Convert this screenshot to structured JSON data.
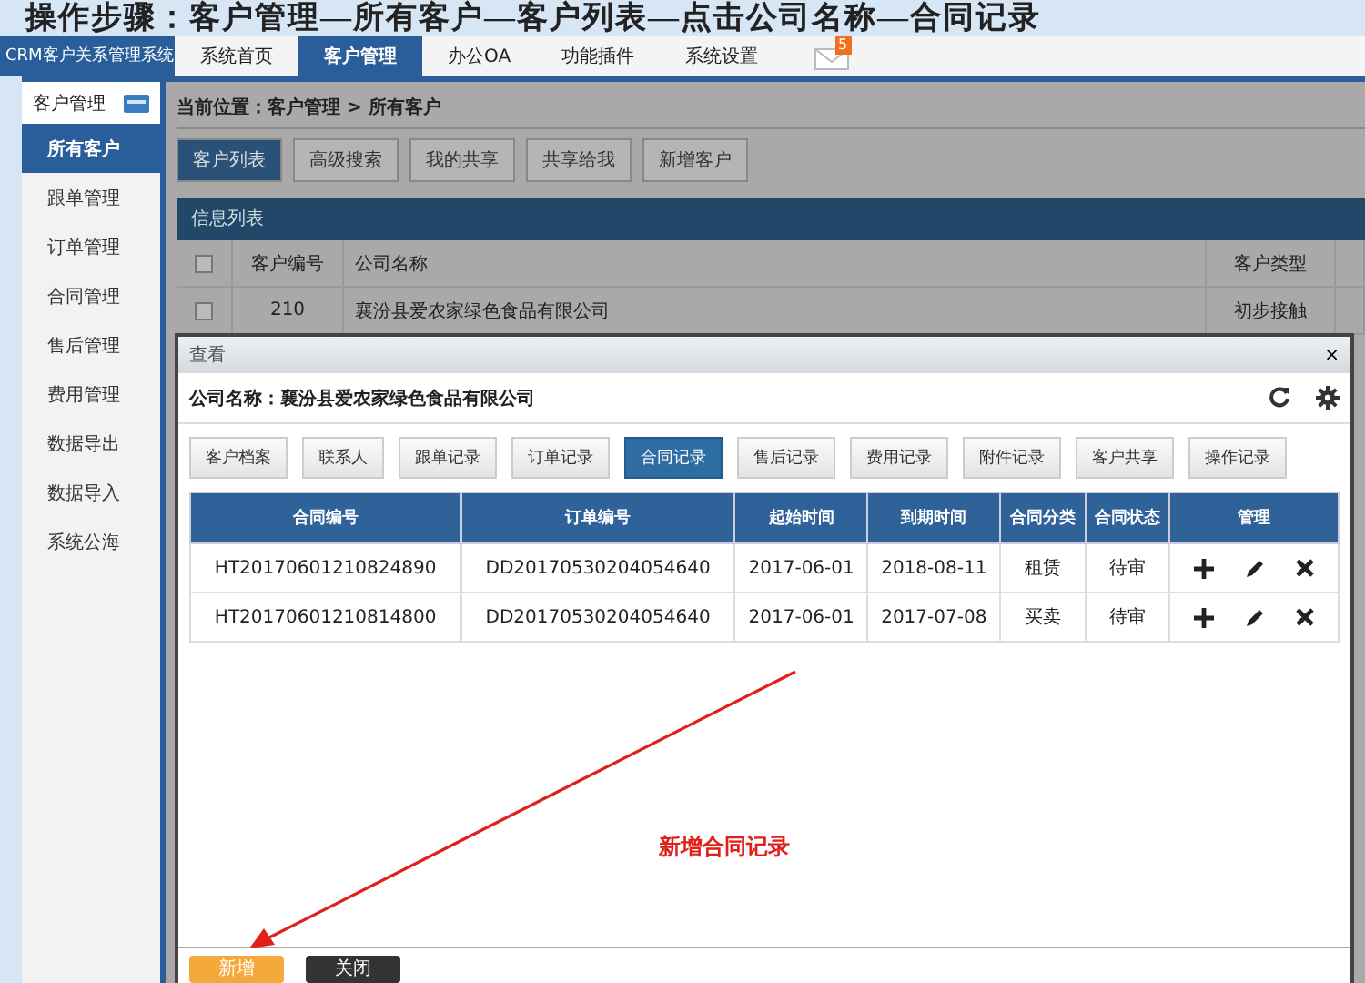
{
  "instruction_banner": "操作步骤：客户管理—所有客户—客户列表—点击公司名称—合同记录",
  "app_title": "CRM客户关系管理系统",
  "nav_tabs": [
    {
      "label": "系统首页",
      "selected": false
    },
    {
      "label": "客户管理",
      "selected": true
    },
    {
      "label": "办公OA",
      "selected": false
    },
    {
      "label": "功能插件",
      "selected": false
    },
    {
      "label": "系统设置",
      "selected": false
    }
  ],
  "mail_badge": "5",
  "sidebar": {
    "title": "客户管理",
    "items": [
      {
        "label": "所有客户",
        "selected": true
      },
      {
        "label": "跟单管理",
        "selected": false
      },
      {
        "label": "订单管理",
        "selected": false
      },
      {
        "label": "合同管理",
        "selected": false
      },
      {
        "label": "售后管理",
        "selected": false
      },
      {
        "label": "费用管理",
        "selected": false
      },
      {
        "label": "数据导出",
        "selected": false
      },
      {
        "label": "数据导入",
        "selected": false
      },
      {
        "label": "系统公海",
        "selected": false
      }
    ]
  },
  "breadcrumb": "当前位置：客户管理 > 所有客户",
  "toolbar_buttons": [
    {
      "label": "客户列表",
      "selected": true
    },
    {
      "label": "高级搜索",
      "selected": false
    },
    {
      "label": "我的共享",
      "selected": false
    },
    {
      "label": "共享给我",
      "selected": false
    },
    {
      "label": "新增客户",
      "selected": false
    }
  ],
  "list_panel": {
    "title": "信息列表",
    "header_checked": false,
    "columns": [
      "客户编号",
      "公司名称",
      "客户类型"
    ],
    "rows": [
      {
        "checked": false,
        "cells": [
          "210",
          "襄汾县爱农家绿色食品有限公司",
          "初步接触"
        ]
      }
    ]
  },
  "dialog": {
    "title": "查看",
    "close": "×",
    "company": "公司名称：襄汾县爱农家绿色食品有限公司",
    "tabs": [
      {
        "label": "客户档案",
        "selected": false
      },
      {
        "label": "联系人",
        "selected": false
      },
      {
        "label": "跟单记录",
        "selected": false
      },
      {
        "label": "订单记录",
        "selected": false
      },
      {
        "label": "合同记录",
        "selected": true
      },
      {
        "label": "售后记录",
        "selected": false
      },
      {
        "label": "费用记录",
        "selected": false
      },
      {
        "label": "附件记录",
        "selected": false
      },
      {
        "label": "客户共享",
        "selected": false
      },
      {
        "label": "操作记录",
        "selected": false
      }
    ],
    "table": {
      "columns": [
        "合同编号",
        "订单编号",
        "起始时间",
        "到期时间",
        "合同分类",
        "合同状态",
        "管理"
      ],
      "rows": [
        {
          "cells": [
            "HT20170601210824890",
            "DD20170530204054640",
            "2017-06-01",
            "2018-08-11",
            "租赁",
            "待审"
          ]
        },
        {
          "cells": [
            "HT20170601210814800",
            "DD20170530204054640",
            "2017-06-01",
            "2017-07-08",
            "买卖",
            "待审"
          ]
        }
      ]
    },
    "buttons": [
      {
        "label": "新增",
        "kind": "primary"
      },
      {
        "label": "关闭",
        "kind": "dark"
      }
    ]
  },
  "annotation": "新增合同记录"
}
